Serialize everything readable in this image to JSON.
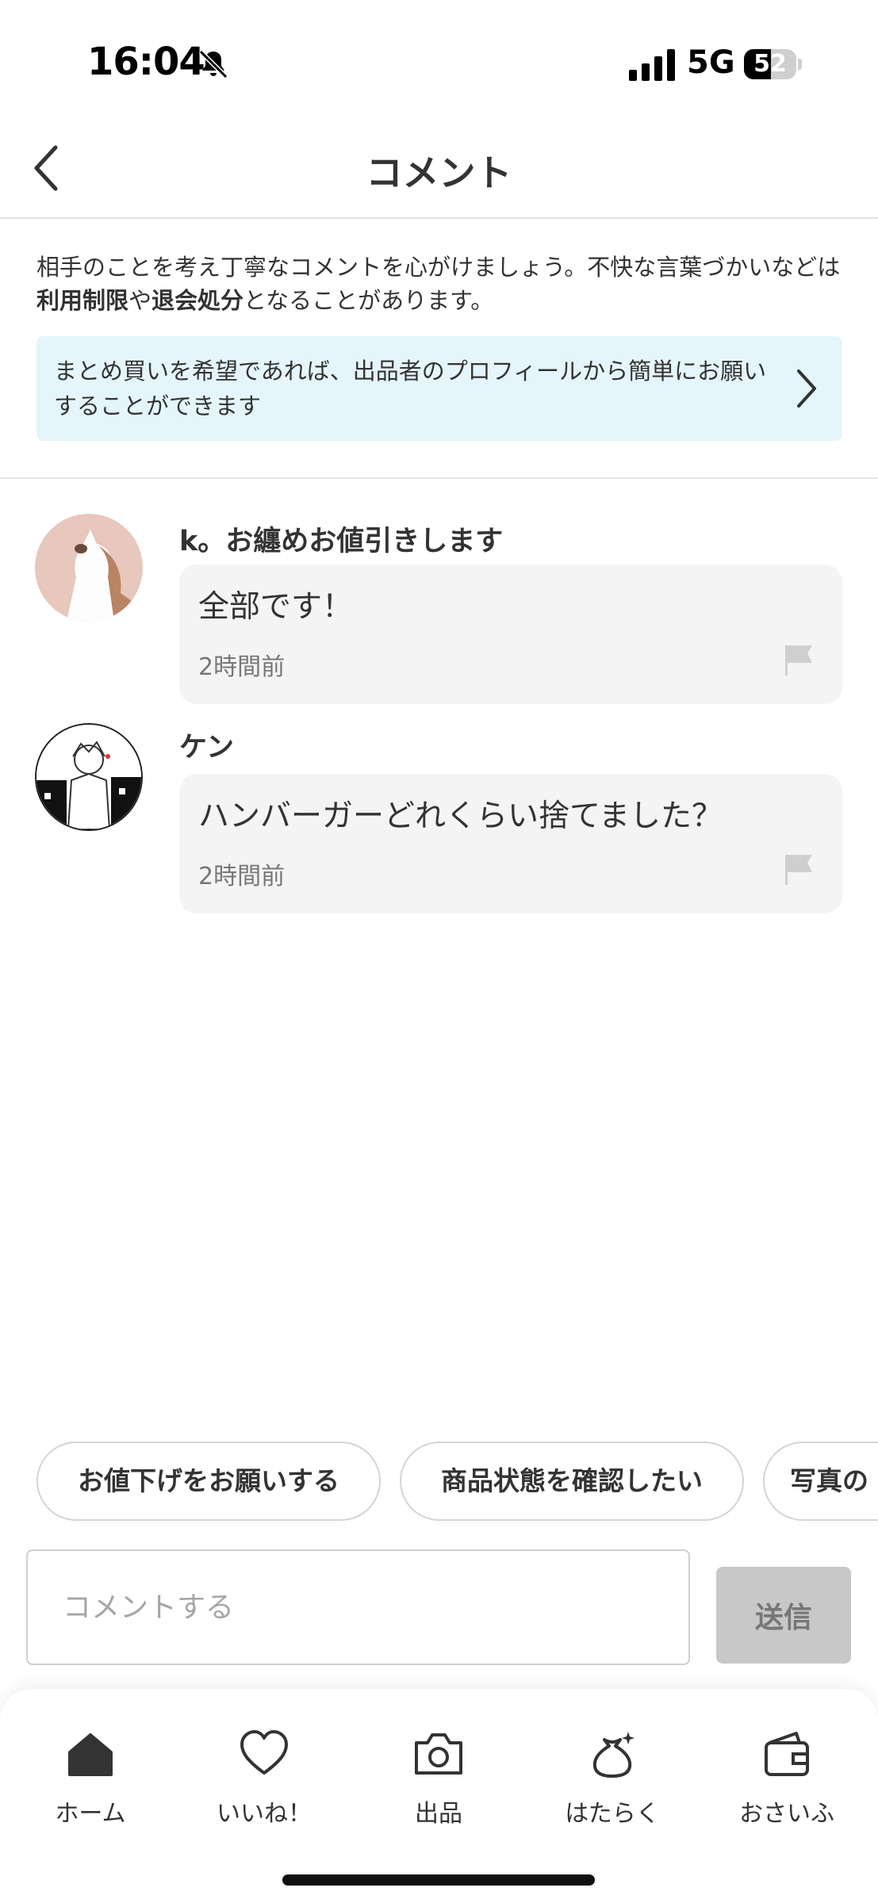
{
  "status_bar": {
    "time": "16:04",
    "network": "5G",
    "battery_percent": "52",
    "battery_level": 0.52
  },
  "header": {
    "title": "コメント",
    "back_icon": "chevron-left-icon"
  },
  "notice": {
    "text_part1": "相手のことを考え丁寧なコメントを心がけましょう。不快な言葉づかいなどは",
    "bold1": "利用制限",
    "text_part2": "や",
    "bold2": "退会処分",
    "text_part3": "となることがあります。"
  },
  "bulk_banner": {
    "text": "まとめ買いを希望であれば、出品者のプロフィールから簡単にお願いすることができます",
    "icon": "chevron-right-icon"
  },
  "comments": [
    {
      "author": "k。お纏めお値引きします",
      "text": "全部です！",
      "time": "2時間前",
      "avatar": "cat-avatar"
    },
    {
      "author": "ケン",
      "text": "ハンバーガーどれくらい捨てました？",
      "time": "2時間前",
      "avatar": "illustration-avatar"
    }
  ],
  "quick_replies": [
    "お値下げをお願いする",
    "商品状態を確認したい",
    "写真の"
  ],
  "input": {
    "placeholder": "コメントする",
    "send_label": "送信"
  },
  "nav": [
    {
      "label": "ホーム",
      "icon": "home-icon"
    },
    {
      "label": "いいね！",
      "icon": "heart-icon"
    },
    {
      "label": "出品",
      "icon": "camera-icon"
    },
    {
      "label": "はたらく",
      "icon": "money-bag-icon"
    },
    {
      "label": "おさいふ",
      "icon": "wallet-icon"
    }
  ],
  "colors": {
    "banner_bg": "#e5f5fc",
    "bubble_bg": "#f4f4f4",
    "send_disabled": "#c8c8c8"
  }
}
